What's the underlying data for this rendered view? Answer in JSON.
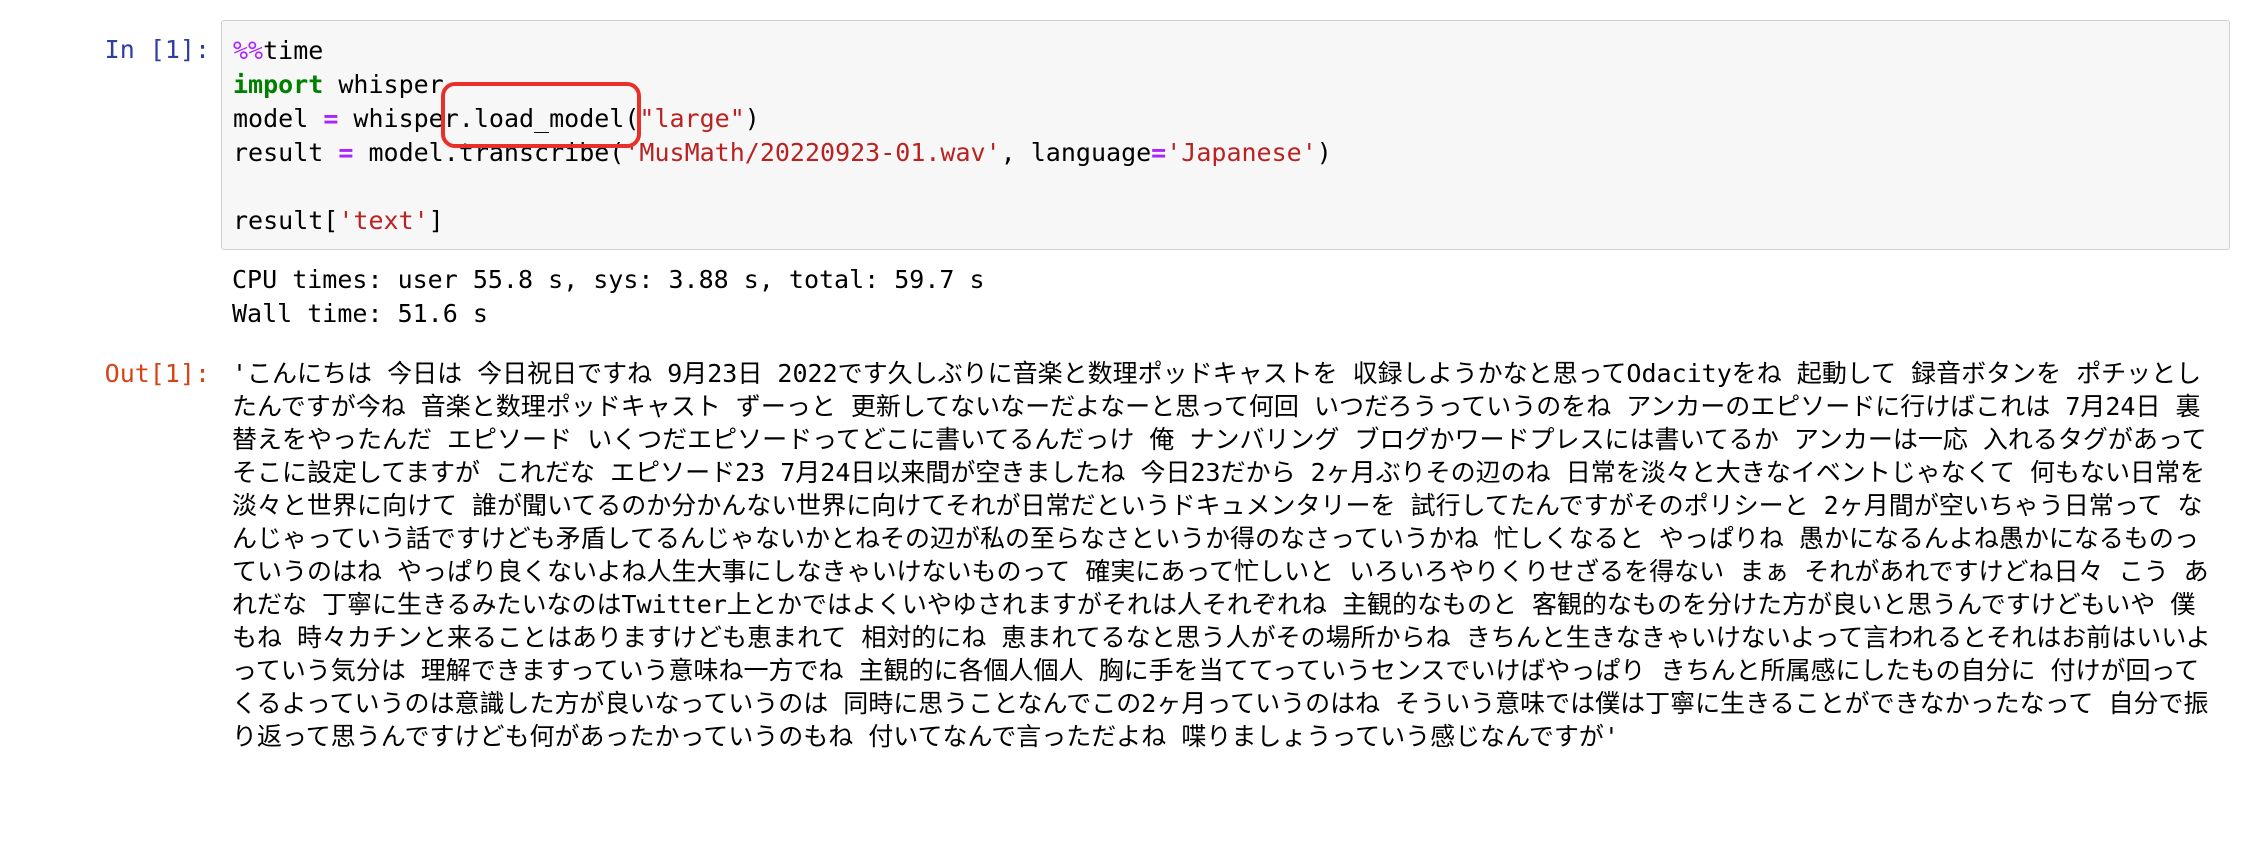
{
  "input_cell": {
    "prompt": "In [1]:",
    "code_lines": [
      [
        {
          "t": "%%",
          "c": "kw-magic"
        },
        {
          "t": "time",
          "c": "name"
        }
      ],
      [
        {
          "t": "import",
          "c": "kw"
        },
        {
          "t": " whisper",
          "c": "name"
        }
      ],
      [
        {
          "t": "model ",
          "c": "name"
        },
        {
          "t": "=",
          "c": "op"
        },
        {
          "t": " whisper.load_model(",
          "c": "name"
        },
        {
          "t": "\"large\"",
          "c": "str"
        },
        {
          "t": ")",
          "c": "name"
        }
      ],
      [
        {
          "t": "result ",
          "c": "name"
        },
        {
          "t": "=",
          "c": "op"
        },
        {
          "t": " model.transcribe(",
          "c": "name"
        },
        {
          "t": "'MusMath/20220923-01.wav'",
          "c": "str"
        },
        {
          "t": ", language",
          "c": "name"
        },
        {
          "t": "=",
          "c": "op"
        },
        {
          "t": "'Japanese'",
          "c": "str"
        },
        {
          "t": ")",
          "c": "name"
        }
      ],
      [],
      [
        {
          "t": "result[",
          "c": "name"
        },
        {
          "t": "'text'",
          "c": "str"
        },
        {
          "t": "]",
          "c": "name"
        }
      ]
    ]
  },
  "stream_output": {
    "line1": "CPU times: user 55.8 s, sys: 3.88 s, total: 59.7 s",
    "line2": "Wall time: 51.6 s"
  },
  "output_cell": {
    "prompt": "Out[1]:",
    "text": "'こんにちは 今日は 今日祝日ですね 9月23日 2022です久しぶりに音楽と数理ポッドキャストを 収録しようかなと思ってOdacityをね 起動して 録音ボタンを ポチッとしたんですが今ね 音楽と数理ポッドキャスト ずーっと 更新してないなーだよなーと思って何回 いつだろうっていうのをね アンカーのエピソードに行けばこれは 7月24日 裏替えをやったんだ エピソード いくつだエピソードってどこに書いてるんだっけ 俺 ナンバリング ブログかワードプレスには書いてるか アンカーは一応 入れるタグがあってそこに設定してますが これだな エピソード23 7月24日以来間が空きましたね 今日23だから 2ヶ月ぶりその辺のね 日常を淡々と大きなイベントじゃなくて 何もない日常を淡々と世界に向けて 誰が聞いてるのか分かんない世界に向けてそれが日常だというドキュメンタリーを 試行してたんですがそのポリシーと 2ヶ月間が空いちゃう日常って なんじゃっていう話ですけども矛盾してるんじゃないかとねその辺が私の至らなさというか得のなさっていうかね 忙しくなると やっぱりね 愚かになるんよね愚かになるものっていうのはね やっぱり良くないよね人生大事にしなきゃいけないものって 確実にあって忙しいと いろいろやりくりせざるを得ない まぁ それがあれですけどね日々 こう あれだな 丁寧に生きるみたいなのはTwitter上とかではよくいやゆされますがそれは人それぞれね 主観的なものと 客観的なものを分けた方が良いと思うんですけどもいや 僕もね 時々カチンと来ることはありますけども恵まれて 相対的にね 恵まれてるなと思う人がその場所からね きちんと生きなきゃいけないよって言われるとそれはお前はいいよっていう気分は 理解できますっていう意味ね一方でね 主観的に各個人個人 胸に手を当ててっていうセンスでいけばやっぱり きちんと所属感にしたもの自分に 付けが回ってくるよっていうのは意識した方が良いなっていうのは 同時に思うことなんでこの2ヶ月っていうのはね そういう意味では僕は丁寧に生きることができなかったなって 自分で振り返って思うんですけども何があったかっていうのもね 付いてなんで言っただよね 喋りましょうっていう感じなんですが'"
  },
  "annotation": {
    "highlight_color": "#e8302a"
  }
}
